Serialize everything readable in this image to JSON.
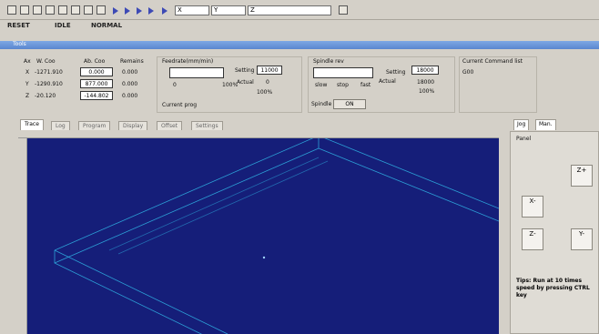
{
  "toolbar": {
    "axis_inputs": [
      "X",
      "Y",
      "Z"
    ]
  },
  "status": {
    "items": [
      "RESET",
      "IDLE",
      "NORMAL"
    ]
  },
  "window": {
    "title": "Tools"
  },
  "axes": {
    "headers": [
      "Ax",
      "W. Coo",
      "Ab. Coo",
      "Remains"
    ],
    "rows": [
      {
        "axis": "X",
        "w": "-1271.910",
        "ab": "0.000",
        "rem": "0.000"
      },
      {
        "axis": "Y",
        "w": "-1290.910",
        "ab": "877.000",
        "rem": "0.000"
      },
      {
        "axis": "Z",
        "w": "-20.120",
        "ab": "-144.802",
        "rem": "0.000"
      }
    ]
  },
  "feed": {
    "title": "Feedrate(mm/min)",
    "scale_left": "0",
    "scale_right": "100%",
    "setting_label": "Setting",
    "setting_value": "11000",
    "actual_label": "Actual",
    "actual_value": "0",
    "percent": "100%",
    "current_label": "Current prog"
  },
  "spindle": {
    "title": "Spindle rev",
    "setting_label": "Setting",
    "setting_value": "18000",
    "actual_label": "Actual",
    "actual_value": "18000",
    "percent": "100%",
    "scale": [
      "slow",
      "stop",
      "fast"
    ],
    "label": "Spindle",
    "button": "ON"
  },
  "command": {
    "title": "Current Command list",
    "value": "G00"
  },
  "tabs": [
    "Trace",
    "Log",
    "Program",
    "Display",
    "Offset",
    "Settings"
  ],
  "side": {
    "tabs": [
      "Jog",
      "Man."
    ],
    "panel_title": "Panel",
    "jog_buttons": [
      {
        "label": "Z+",
        "id": "z-plus"
      },
      {
        "label": "X-",
        "id": "x-minus"
      },
      {
        "label": "Z-",
        "id": "z-minus"
      },
      {
        "label": "Y-",
        "id": "y-minus"
      }
    ],
    "tips": "Tips: Run at 10 times speed by pressing CTRL key"
  },
  "colors": {
    "viewport": "#151e79",
    "wireframe": "#2c9fd6",
    "titlebar": "#6e98dc"
  }
}
